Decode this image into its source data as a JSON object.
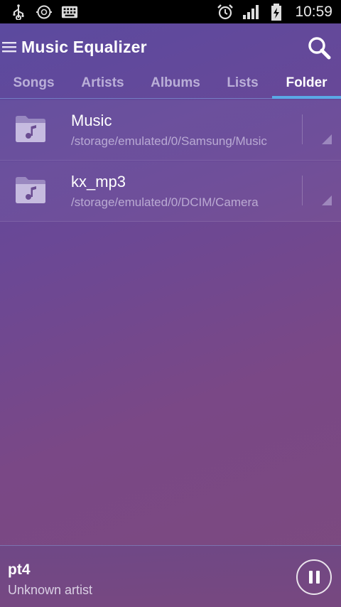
{
  "status_bar": {
    "time": "10:59",
    "icons": [
      "usb-icon",
      "sync-icon",
      "keyboard-icon",
      "alarm-icon",
      "signal-icon",
      "battery-icon"
    ]
  },
  "action_bar": {
    "title": "Music Equalizer",
    "menu_icon": "hamburger-menu-icon",
    "search_icon": "search-icon"
  },
  "tabs": [
    {
      "label": "Songs",
      "active": false
    },
    {
      "label": "Artists",
      "active": false
    },
    {
      "label": "Albums",
      "active": false
    },
    {
      "label": "Lists",
      "active": false
    },
    {
      "label": "Folder",
      "active": true
    }
  ],
  "folders": [
    {
      "name": "Music",
      "path": "/storage/emulated/0/Samsung/Music"
    },
    {
      "name": "kx_mp3",
      "path": "/storage/emulated/0/DCIM/Camera"
    }
  ],
  "now_playing": {
    "title": "pt4",
    "artist": "Unknown artist"
  },
  "colors": {
    "accent": "#5aa8e6",
    "background_top": "#5a4aa0",
    "background_bottom": "#7c4a7e",
    "status_bar": "#000000"
  }
}
